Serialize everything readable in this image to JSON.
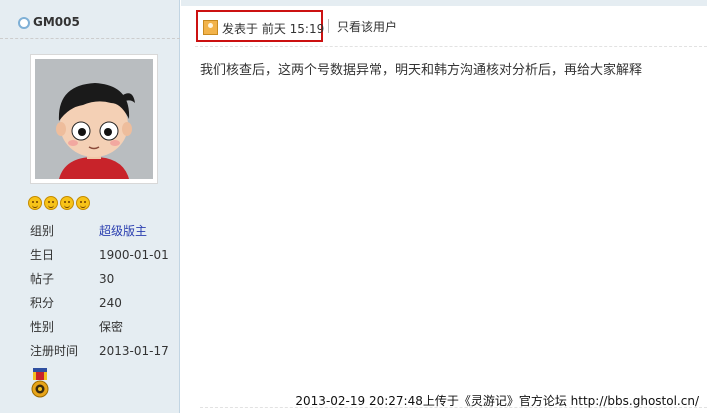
{
  "user": {
    "name": "GM005",
    "stars": 4,
    "info": [
      {
        "label": "组别",
        "value": "超级版主",
        "link": true
      },
      {
        "label": "生日",
        "value": "1900-01-01",
        "link": false
      },
      {
        "label": "帖子",
        "value": "30",
        "link": false
      },
      {
        "label": "积分",
        "value": "240",
        "link": false
      },
      {
        "label": "性别",
        "value": "保密",
        "link": false
      },
      {
        "label": "注册时间",
        "value": "2013-01-17",
        "link": false
      }
    ]
  },
  "post": {
    "posted_label": "发表于 前天 15:19",
    "only_user_link": "只看该用户",
    "body": "我们核查后，这两个号数据异常，明天和韩方沟通核对分析后，再给大家解释"
  },
  "watermark": "2013-02-19 20:27:48上传于《灵游记》官方论坛 http://bbs.ghostol.cn/",
  "colors": {
    "sidebar_bg": "#e5edf2",
    "highlight_box": "#cc1111",
    "group_link": "#2b3fb0"
  }
}
